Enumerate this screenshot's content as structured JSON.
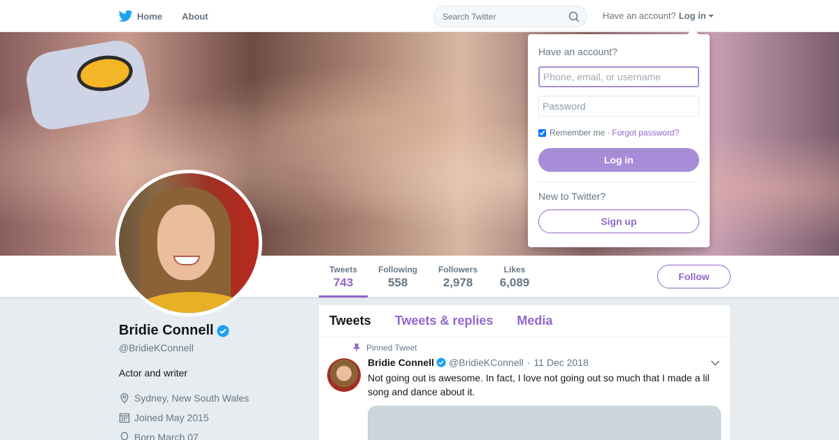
{
  "nav": {
    "home_label": "Home",
    "about_label": "About",
    "search_placeholder": "Search Twitter",
    "have_account": "Have an account?",
    "login_label": "Log in"
  },
  "profile": {
    "name": "Bridie Connell",
    "handle": "@BridieKConnell",
    "bio": "Actor and writer",
    "location": "Sydney, New South Wales",
    "joined": "Joined May 2015",
    "born": "Born March 07"
  },
  "stats": [
    {
      "label": "Tweets",
      "value": "743"
    },
    {
      "label": "Following",
      "value": "558"
    },
    {
      "label": "Followers",
      "value": "2,978"
    },
    {
      "label": "Likes",
      "value": "6,089"
    }
  ],
  "follow_label": "Follow",
  "timeline": {
    "tabs": [
      "Tweets",
      "Tweets & replies",
      "Media"
    ],
    "pinned_label": "Pinned Tweet",
    "tweet": {
      "name": "Bridie Connell",
      "handle": "@BridieKConnell",
      "dot": "·",
      "date": "11 Dec 2018",
      "text": "Not going out is awesome. In fact, I love not going out so much that I made a lil song and dance about it."
    }
  },
  "login_dropdown": {
    "title": "Have an account?",
    "username_placeholder": "Phone, email, or username",
    "password_placeholder": "Password",
    "remember_label": "Remember me",
    "separator": "·",
    "forgot_label": "Forgot password?",
    "login_button": "Log in",
    "new_label": "New to Twitter?",
    "signup_button": "Sign up"
  },
  "colors": {
    "accent": "#9266cc",
    "twitter_blue": "#1da1f2",
    "background": "#e6ecf0"
  }
}
